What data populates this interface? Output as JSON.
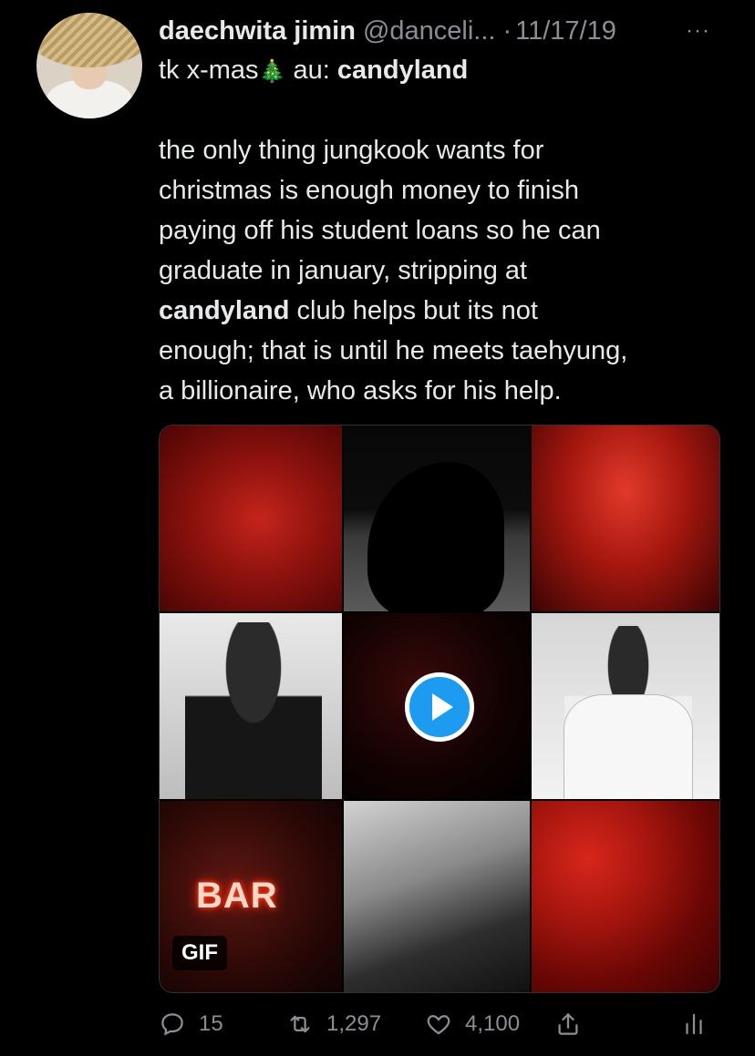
{
  "tweet": {
    "display_name": "daechwita jimin",
    "handle": "@danceli...",
    "separator": "·",
    "date": "11/17/19",
    "more_label": "···",
    "title": {
      "prefix": "tk x-mas",
      "emoji": "🎄",
      "middle": " au: ",
      "bold": "candyland"
    },
    "body": {
      "line1": "the only thing jungkook wants for",
      "line2": "christmas is enough money to finish",
      "line3": "paying off his student loans so he can",
      "line4": "graduate in january, stripping at",
      "line5_bold": "candyland",
      "line5_rest": " club helps but its not",
      "line6": "enough; that is until he meets taehyung,",
      "line7": "a billionaire, who asks for his help."
    },
    "media": {
      "neon_text": "BAR",
      "gif_badge": "GIF"
    },
    "actions": {
      "replies": "15",
      "retweets": "1,297",
      "likes": "4,100"
    }
  },
  "icons": [
    "reply-icon",
    "retweet-icon",
    "heart-icon",
    "share-icon",
    "analytics-icon",
    "play-icon",
    "more-icon"
  ],
  "colors": {
    "background": "#000000",
    "text": "#e7e9ea",
    "secondary": "#8b8f94",
    "accent": "#1d9bf0"
  }
}
